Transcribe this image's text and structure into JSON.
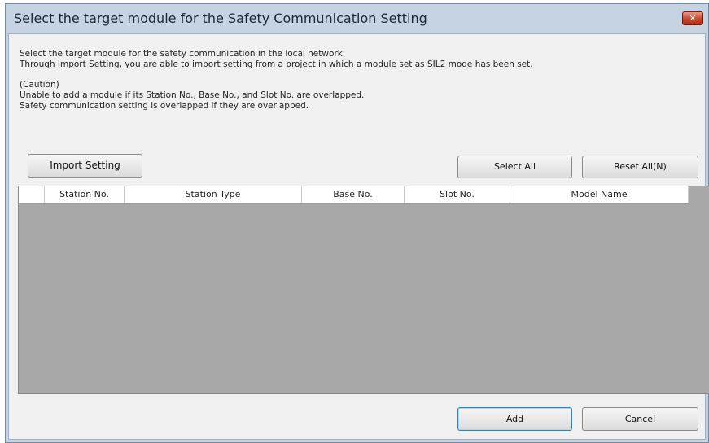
{
  "window": {
    "title": "Select the target module for the Safety Communication Setting",
    "close_glyph": "✕"
  },
  "description": {
    "line1": "Select the target module for the safety communication in the local network.",
    "line2": "Through Import Setting, you are able to import setting from a project in which a module set as SIL2 mode has been set.",
    "caution_heading": "(Caution)",
    "caution_line1": "Unable to add a module if its Station No., Base No., and Slot No. are overlapped.",
    "caution_line2": "Safety communication setting is overlapped if they are overlapped."
  },
  "toolbar": {
    "import_label": "Import Setting",
    "select_all_label": "Select All",
    "reset_all_label": "Reset All(N)"
  },
  "table": {
    "columns": [
      "",
      "Station No.",
      "Station Type",
      "Base No.",
      "Slot No.",
      "Model Name"
    ],
    "rows": []
  },
  "footer": {
    "add_label": "Add",
    "cancel_label": "Cancel"
  },
  "colors": {
    "title_bg": "#c5d3e2",
    "client_bg": "#f0f0f0",
    "grid_empty_bg": "#a8a8a8",
    "close_button": "#c9452a"
  }
}
